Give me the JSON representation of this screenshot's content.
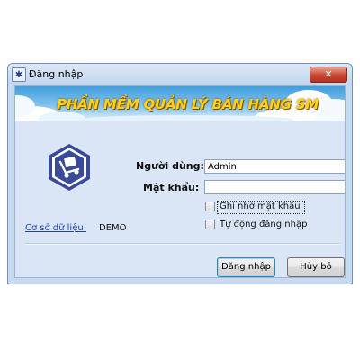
{
  "window": {
    "title": "Đăng nhập",
    "close_glyph": "✕",
    "app_icon": "app-logo-icon"
  },
  "banner": {
    "title": "PHẦN MỀM QUẢN LÝ BÁN HÀNG SM"
  },
  "form": {
    "user_label": "Người dùng:",
    "user_value": "Admin",
    "password_label": "Mật khẩu:",
    "password_value": "",
    "remember_label": "Ghi nhớ mật khẩu",
    "remember_checked": false,
    "auto_login_label": "Tự động đăng nhập",
    "auto_login_checked": false
  },
  "database": {
    "link_label": "Cơ sở dữ liệu:",
    "value": "DEMO"
  },
  "buttons": {
    "login_label": "Đăng nhập",
    "cancel_label": "Hủy bỏ"
  },
  "colors": {
    "window_bg": "#c9d9ee",
    "banner_sky": "#3f9edb",
    "banner_text": "#ffd21a",
    "logo_fill": "#3a4a99",
    "link": "#1c3fb0"
  }
}
